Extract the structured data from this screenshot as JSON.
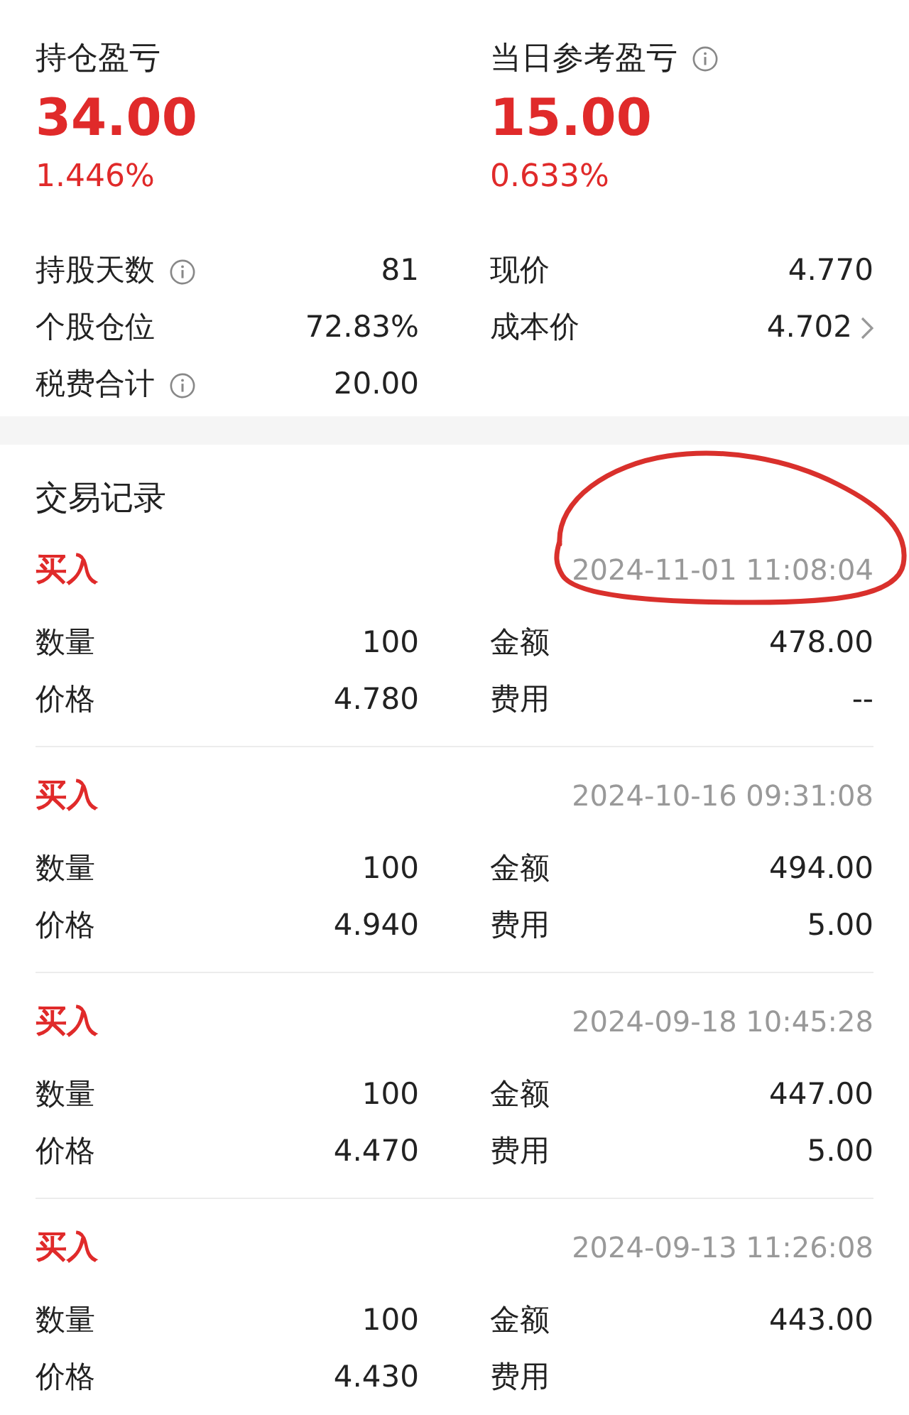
{
  "summary": [
    {
      "label": "持仓盈亏",
      "info": false,
      "value": "34.00",
      "percent": "1.446%"
    },
    {
      "label": "当日参考盈亏",
      "info": true,
      "value": "15.00",
      "percent": "0.633%"
    }
  ],
  "stats": [
    {
      "label": "持股天数",
      "info": true,
      "value": "81",
      "chevron": false
    },
    {
      "label": "现价",
      "info": false,
      "value": "4.770",
      "chevron": false
    },
    {
      "label": "个股仓位",
      "info": false,
      "value": "72.83%",
      "chevron": false
    },
    {
      "label": "成本价",
      "info": false,
      "value": "4.702",
      "chevron": true
    },
    {
      "label": "税费合计",
      "info": true,
      "value": "20.00",
      "chevron": false
    }
  ],
  "records_title": "交易记录",
  "records": [
    {
      "type": "买入",
      "time": "2024-11-01 11:08:04",
      "circled": true,
      "fields": [
        {
          "label": "数量",
          "value": "100"
        },
        {
          "label": "金额",
          "value": "478.00"
        },
        {
          "label": "价格",
          "value": "4.780"
        },
        {
          "label": "费用",
          "value": "--"
        }
      ]
    },
    {
      "type": "买入",
      "time": "2024-10-16 09:31:08",
      "circled": false,
      "fields": [
        {
          "label": "数量",
          "value": "100"
        },
        {
          "label": "金额",
          "value": "494.00"
        },
        {
          "label": "价格",
          "value": "4.940"
        },
        {
          "label": "费用",
          "value": "5.00"
        }
      ]
    },
    {
      "type": "买入",
      "time": "2024-09-18 10:45:28",
      "circled": false,
      "fields": [
        {
          "label": "数量",
          "value": "100"
        },
        {
          "label": "金额",
          "value": "447.00"
        },
        {
          "label": "价格",
          "value": "4.470"
        },
        {
          "label": "费用",
          "value": "5.00"
        }
      ]
    },
    {
      "type": "买入",
      "time": "2024-09-13 11:26:08",
      "circled": false,
      "fields": [
        {
          "label": "数量",
          "value": "100"
        },
        {
          "label": "金额",
          "value": "443.00"
        },
        {
          "label": "价格",
          "value": "4.430"
        },
        {
          "label": "费用"
        }
      ]
    }
  ]
}
